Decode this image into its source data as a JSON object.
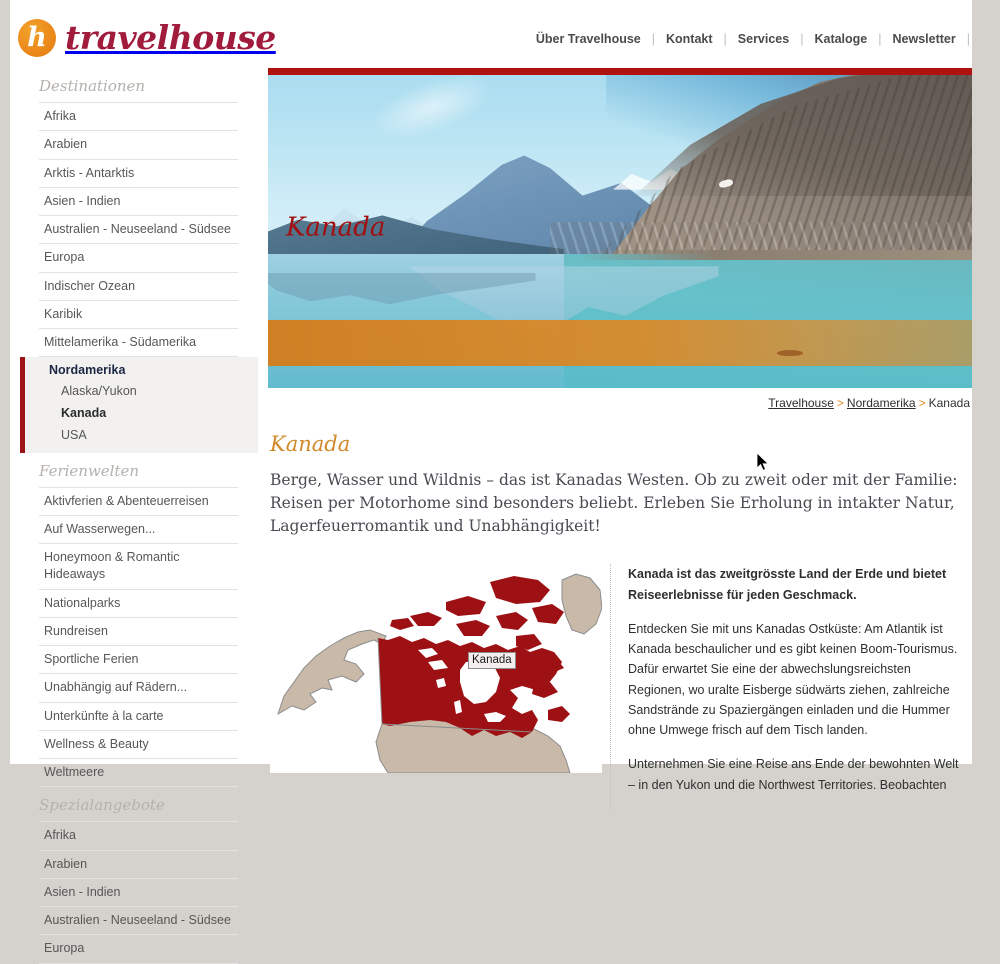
{
  "brand": {
    "logo_icon": "travelhouse-h-circle-icon",
    "name": "travelhouse",
    "logo_letter": "h",
    "accent_orange": "#e07d11",
    "accent_red": "#a01b3c"
  },
  "topnav": {
    "items": [
      {
        "label": "Über Travelhouse"
      },
      {
        "label": "Kontakt"
      },
      {
        "label": "Services"
      },
      {
        "label": "Kataloge"
      },
      {
        "label": "Newsletter"
      }
    ],
    "separator": "|"
  },
  "sidebar": {
    "groups": [
      {
        "title": "Destinationen",
        "items": [
          {
            "label": "Afrika"
          },
          {
            "label": "Arabien"
          },
          {
            "label": "Arktis - Antarktis"
          },
          {
            "label": "Asien - Indien"
          },
          {
            "label": "Australien - Neuseeland - Südsee"
          },
          {
            "label": "Europa"
          },
          {
            "label": "Indischer Ozean"
          },
          {
            "label": "Karibik"
          },
          {
            "label": "Mittelamerika - Südamerika"
          }
        ],
        "active_group": {
          "label": "Nordamerika",
          "children": [
            {
              "label": "Alaska/Yukon",
              "current": false
            },
            {
              "label": "Kanada",
              "current": true
            },
            {
              "label": "USA",
              "current": false
            }
          ]
        }
      },
      {
        "title": "Ferienwelten",
        "items": [
          {
            "label": "Aktivferien & Abenteuerreisen"
          },
          {
            "label": "Auf Wasserwegen..."
          },
          {
            "label": "Honeymoon & Romantic Hideaways"
          },
          {
            "label": "Nationalparks"
          },
          {
            "label": "Rundreisen"
          },
          {
            "label": "Sportliche Ferien"
          },
          {
            "label": "Unabhängig auf Rädern..."
          },
          {
            "label": "Unterkünfte à la carte"
          },
          {
            "label": "Wellness & Beauty"
          },
          {
            "label": "Weltmeere"
          }
        ]
      },
      {
        "title": "Spezialangebote",
        "items": [
          {
            "label": "Afrika"
          },
          {
            "label": "Arabien"
          },
          {
            "label": "Asien - Indien"
          },
          {
            "label": "Australien - Neuseeland - Südsee"
          },
          {
            "label": "Europa"
          }
        ]
      }
    ]
  },
  "hero": {
    "caption": "Kanada",
    "image_alt": "Bergsee mit Gebirge in Kanada",
    "topbar_color": "#b01212",
    "band_color": "#d37d1c"
  },
  "breadcrumb": {
    "items": [
      {
        "label": "Travelhouse",
        "link": true
      },
      {
        "label": "Nordamerika",
        "link": true
      },
      {
        "label": "Kanada",
        "link": false
      }
    ],
    "separator": ">"
  },
  "content": {
    "title": "Kanada",
    "intro": "Berge, Wasser und Wildnis – das ist Kanadas Westen. Ob zu zweit oder mit der Familie: Reisen per Motorhome sind besonders beliebt. Erleben Sie Erholung in intakter Natur, Lagerfeuerromantik und Unabhängigkeit!",
    "paragraphs": [
      "Kanada ist das zweitgrösste Land der Erde und bietet Reiseerlebnisse für jeden Geschmack.",
      "Entdecken Sie mit uns Kanadas Ostküste: Am Atlantik ist Kanada beschaulicher und es gibt keinen Boom-Tourismus. Dafür erwartet Sie eine der abwechslungsreichsten Regionen, wo uralte Eisberge südwärts ziehen, zahlreiche Sandstrände zu Spaziergängen einladen und die Hummer ohne Umwege frisch auf dem Tisch landen.",
      "Unternehmen Sie eine Reise ans Ende der bewohnten Welt – in den Yukon und die Northwest Territories. Beobachten"
    ]
  },
  "map": {
    "label": "Kanada",
    "highlight_color": "#9d1014",
    "neighbor_color": "#c8b9a8",
    "alt": "Karte von Nordamerika mit hervorgehobenem Kanada"
  }
}
